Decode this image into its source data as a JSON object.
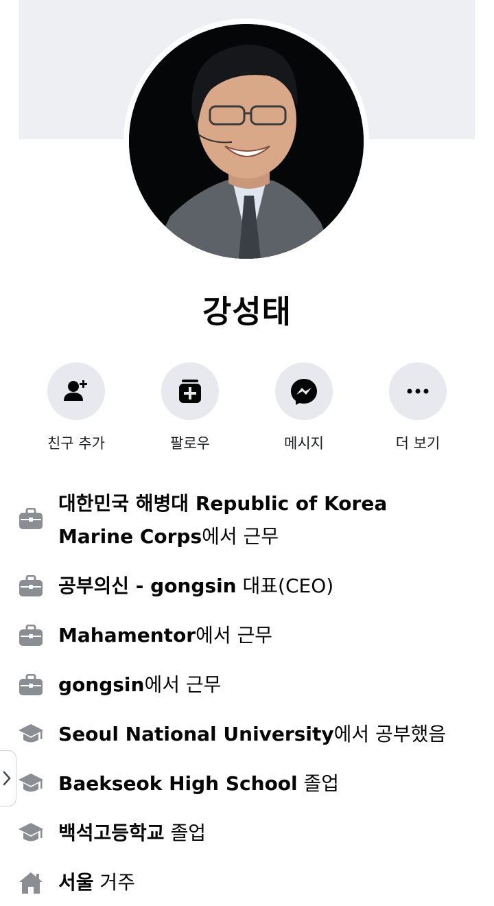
{
  "profile": {
    "name": "강성태"
  },
  "actions": [
    {
      "label": "친구 추가",
      "icon": "add-friend-icon"
    },
    {
      "label": "팔로우",
      "icon": "follow-icon"
    },
    {
      "label": "메시지",
      "icon": "messenger-icon"
    },
    {
      "label": "더 보기",
      "icon": "more-icon"
    }
  ],
  "info": [
    {
      "icon": "briefcase-icon",
      "bold": "대한민국 해병대 Republic of Korea Marine Corps",
      "rest": "에서 근무"
    },
    {
      "icon": "briefcase-icon",
      "bold": "공부의신 - gongsin",
      "rest": " 대표(CEO)"
    },
    {
      "icon": "briefcase-icon",
      "bold": "Mahamentor",
      "rest": "에서 근무"
    },
    {
      "icon": "briefcase-icon",
      "bold": "gongsin",
      "rest": "에서 근무"
    },
    {
      "icon": "graduation-cap-icon",
      "bold": "Seoul National University",
      "rest": "에서 공부했음"
    },
    {
      "icon": "graduation-cap-icon",
      "bold": "Baekseok High School",
      "rest": " 졸업"
    },
    {
      "icon": "graduation-cap-icon",
      "bold": "백석고등학교",
      "rest": " 졸업"
    },
    {
      "icon": "home-icon",
      "bold": "서울",
      "rest": " 거주"
    }
  ],
  "colors": {
    "cover": "#eeeff2",
    "action_circle": "#e8e9ee",
    "icon": "#8a8d91",
    "text": "#050505"
  }
}
